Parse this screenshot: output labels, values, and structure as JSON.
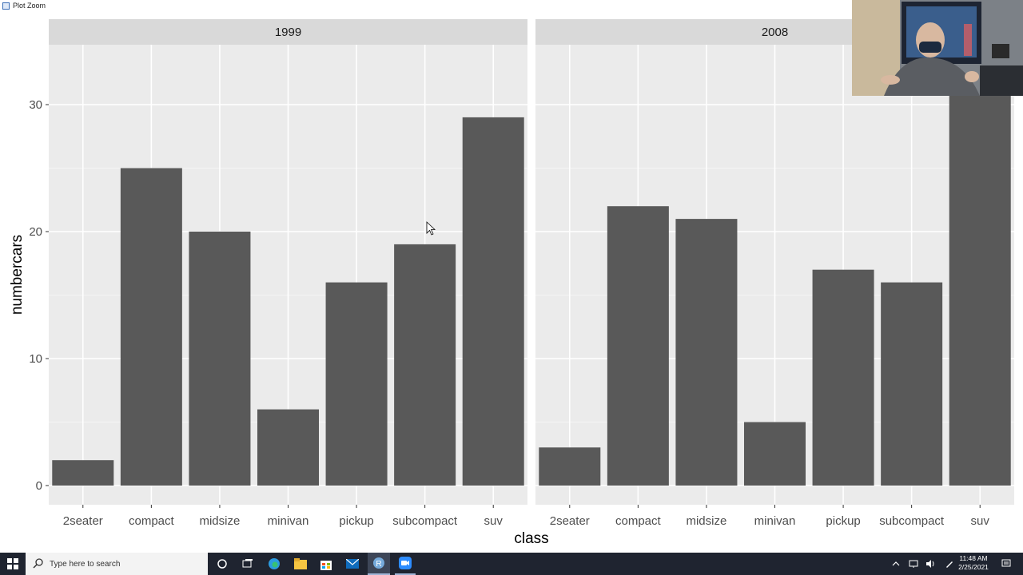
{
  "window": {
    "title": "Plot Zoom"
  },
  "chart_data": {
    "type": "bar",
    "xlabel": "class",
    "ylabel": "numbercars",
    "ylim": [
      0,
      35
    ],
    "yticks": [
      0,
      10,
      20,
      30
    ],
    "grid": true,
    "categories": [
      "2seater",
      "compact",
      "midsize",
      "minivan",
      "pickup",
      "subcompact",
      "suv"
    ],
    "facets": [
      {
        "label": "1999",
        "values": [
          2,
          25,
          20,
          6,
          16,
          19,
          29
        ]
      },
      {
        "label": "2008",
        "values": [
          3,
          22,
          21,
          5,
          17,
          16,
          33
        ]
      }
    ]
  },
  "colors": {
    "bar": "#595959",
    "panel": "#ebebeb",
    "strip": "#d9d9d9",
    "grid_major": "#ffffff",
    "grid_minor": "#f5f5f5",
    "taskbar": "#1f2430"
  },
  "taskbar": {
    "search_placeholder": "Type here to search",
    "clock_time": "11:48 AM",
    "clock_date": "2/25/2021",
    "icons": [
      "windows-start-icon",
      "search-icon",
      "cortana-icon",
      "task-view-icon",
      "edge-icon",
      "file-explorer-icon",
      "store-icon",
      "mail-icon",
      "r-icon",
      "zoom-icon",
      "chevron-up-icon",
      "network-icon",
      "volume-icon",
      "pen-icon",
      "notification-icon"
    ]
  }
}
